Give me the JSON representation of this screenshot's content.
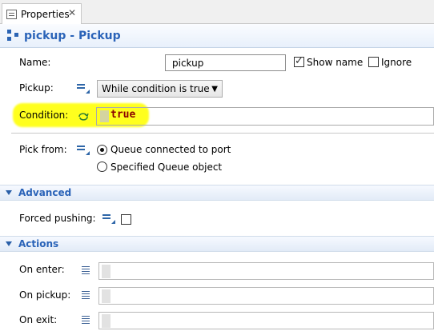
{
  "tab": {
    "title": "Properties",
    "close": "✕"
  },
  "header": {
    "title": "pickup - Pickup"
  },
  "form": {
    "name_label": "Name:",
    "name_value": "pickup",
    "show_name_label": "Show name",
    "show_name_checked": true,
    "ignore_label": "Ignore",
    "ignore_checked": false,
    "pickup_label": "Pickup:",
    "pickup_value": "While condition is true",
    "condition_label": "Condition:",
    "condition_value": "true",
    "pick_from_label": "Pick from:",
    "pick_from_options": [
      "Queue connected to port",
      "Specified Queue object"
    ],
    "pick_from_selected": 0
  },
  "advanced": {
    "title": "Advanced",
    "forced_pushing_label": "Forced pushing:",
    "forced_pushing_checked": false
  },
  "actions": {
    "title": "Actions",
    "on_enter_label": "On enter:",
    "on_pickup_label": "On pickup:",
    "on_exit_label": "On exit:"
  },
  "colors": {
    "accent": "#2a63b8",
    "highlight": "#ffff1e",
    "code": "#8b0000"
  }
}
